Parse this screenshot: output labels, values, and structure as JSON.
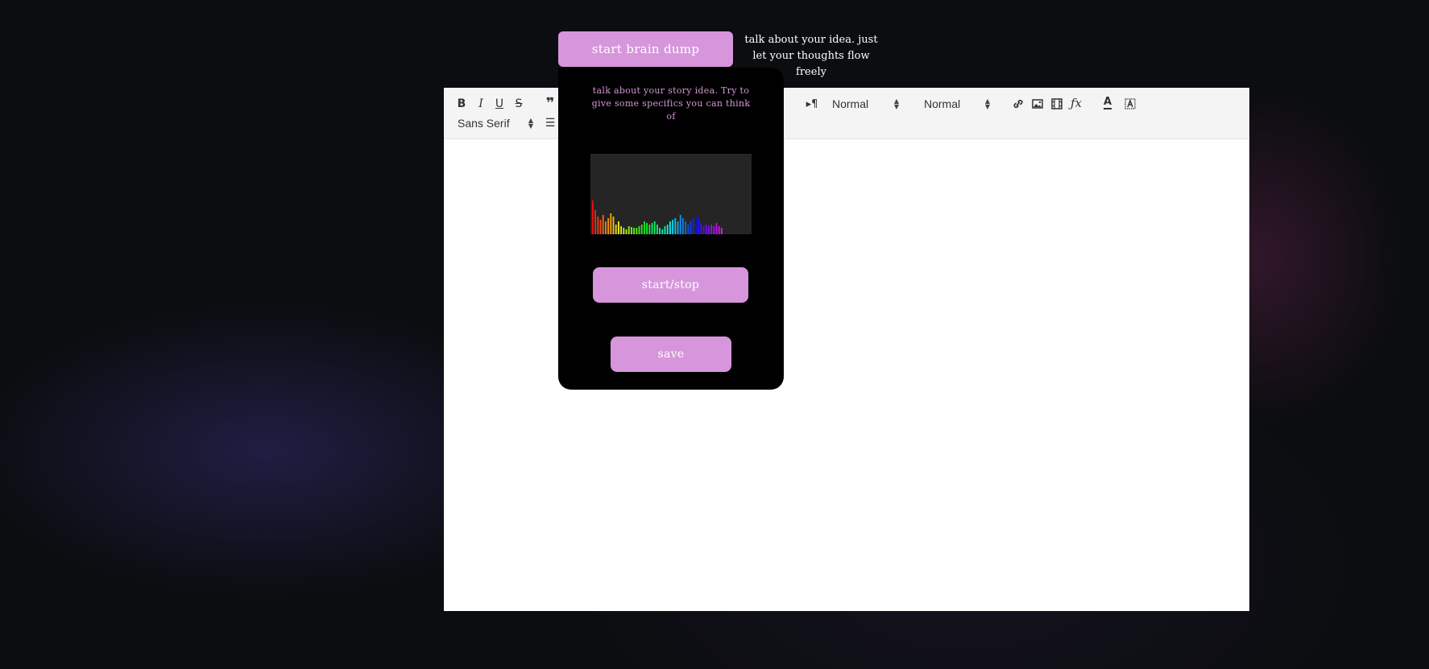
{
  "header": {
    "brain_dump_label": "start brain dump",
    "hint": "talk about your idea. just let your thoughts flow freely"
  },
  "editor": {
    "toolbar": {
      "header_select": "Normal",
      "size_select": "Normal",
      "font_select": "Sans Serif",
      "icons": [
        "bold-icon",
        "italic-icon",
        "underline-icon",
        "strike-icon",
        "blockquote-icon",
        "direction-icon",
        "link-icon",
        "image-icon",
        "video-icon",
        "formula-icon",
        "text-color-icon",
        "background-color-icon",
        "list-icon"
      ]
    },
    "content": ""
  },
  "brain_dump_panel": {
    "hint": "talk about your story idea. Try to give some specifics you can think of",
    "start_stop_label": "start/stop",
    "save_label": "save",
    "visualizer_levels": [
      0.42,
      0.3,
      0.22,
      0.18,
      0.24,
      0.16,
      0.2,
      0.26,
      0.22,
      0.12,
      0.16,
      0.1,
      0.08,
      0.06,
      0.1,
      0.09,
      0.08,
      0.08,
      0.1,
      0.12,
      0.16,
      0.14,
      0.12,
      0.14,
      0.16,
      0.12,
      0.08,
      0.06,
      0.1,
      0.12,
      0.16,
      0.18,
      0.2,
      0.16,
      0.24,
      0.2,
      0.16,
      0.12,
      0.16,
      0.2,
      0.22,
      0.2,
      0.14,
      0.1,
      0.12,
      0.1,
      0.12,
      0.1,
      0.14,
      0.1,
      0.08
    ]
  },
  "colors": {
    "accent": "#d796dc",
    "panel_bg": "#000000",
    "visualizer_bg": "#252525"
  }
}
